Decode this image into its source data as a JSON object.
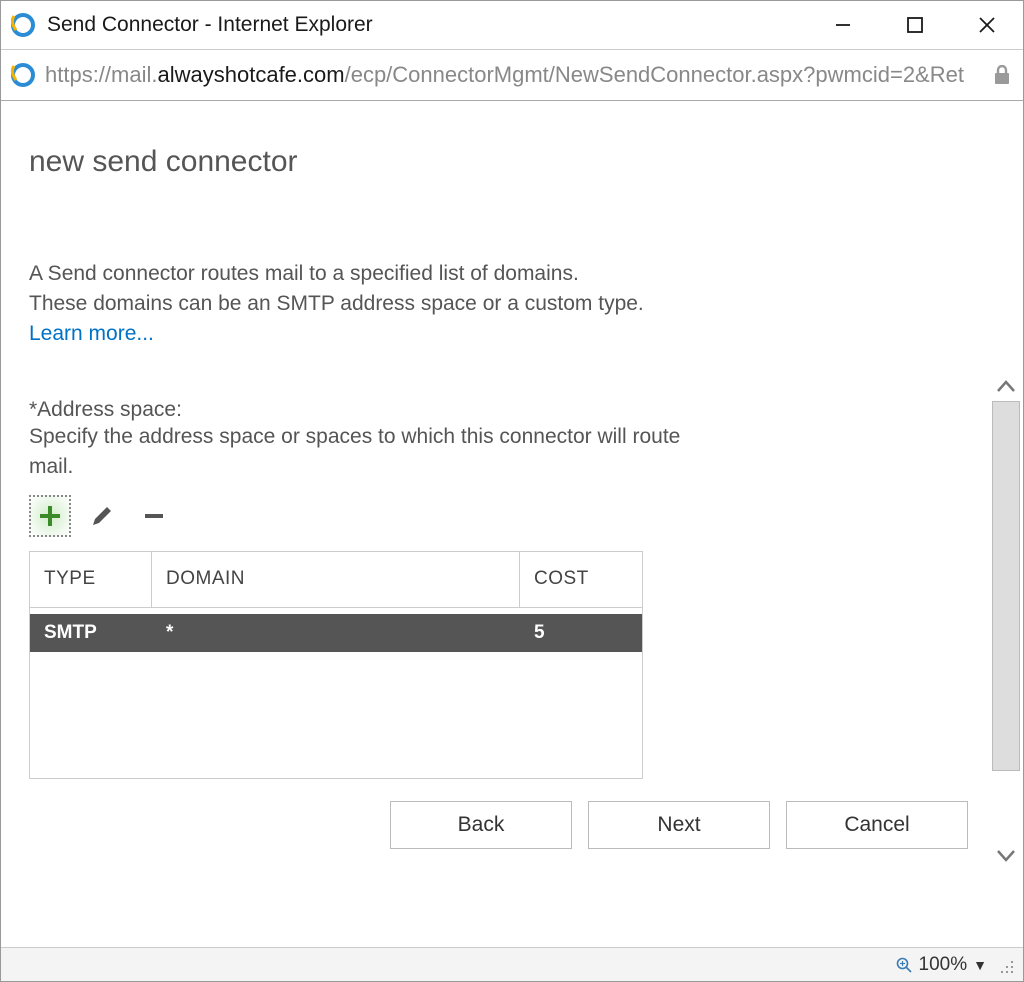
{
  "window": {
    "title": "Send Connector - Internet Explorer"
  },
  "address": {
    "scheme": "https://",
    "subdomain": "mail.",
    "domain": "alwayshotcafe.com",
    "path": "/ecp/ConnectorMgmt/NewSendConnector.aspx?pwmcid=2&Ret"
  },
  "page": {
    "heading": "new send connector",
    "desc_line1": "A Send connector routes mail to a specified list of domains.",
    "desc_line2": "These domains can be an SMTP address space or a custom type.",
    "learn_more": "Learn more...",
    "field_label": "*Address space:",
    "field_help": "Specify the address space or spaces to which this connector will route mail."
  },
  "table": {
    "headers": {
      "type": "TYPE",
      "domain": "DOMAIN",
      "cost": "COST"
    },
    "rows": [
      {
        "type": "SMTP",
        "domain": "*",
        "cost": "5"
      }
    ]
  },
  "buttons": {
    "back": "Back",
    "next": "Next",
    "cancel": "Cancel"
  },
  "status": {
    "zoom": "100%"
  }
}
